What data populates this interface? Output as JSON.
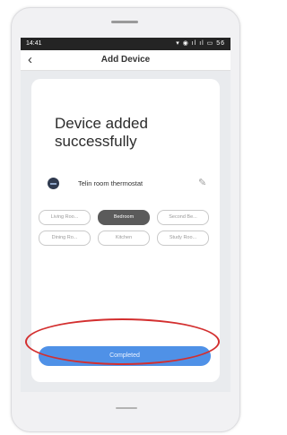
{
  "status_bar": {
    "time": "14:41",
    "icons_text": "▾ ◉ ıl ıl ▭ 56"
  },
  "nav": {
    "back_symbol": "‹",
    "title": "Add Device"
  },
  "headline": "Device added successfully",
  "device": {
    "name": "Telin room thermostat",
    "edit_symbol": "✎"
  },
  "rooms": [
    {
      "label": "Living Roo...",
      "selected": false
    },
    {
      "label": "Bedroom",
      "selected": true
    },
    {
      "label": "Second Be...",
      "selected": false
    },
    {
      "label": "Dining Ro...",
      "selected": false
    },
    {
      "label": "Kitchen",
      "selected": false
    },
    {
      "label": "Study Roo...",
      "selected": false
    }
  ],
  "complete_button": {
    "label": "Completed"
  },
  "colors": {
    "accent": "#4f91e7",
    "annotation": "#d32f2f",
    "selected_chip": "#5b5b5b"
  }
}
